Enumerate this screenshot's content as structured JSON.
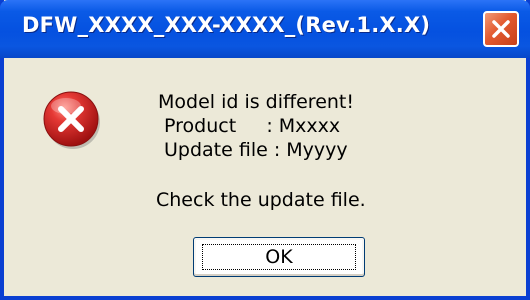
{
  "window": {
    "title": "DFW_XXXX_XXX-XXXX_(Rev.1.X.X)"
  },
  "message": {
    "line1": "Model id is different!",
    "line2": "Product     : Mxxxx",
    "line3": "Update file : Myyyy",
    "instruction": "Check the update file."
  },
  "buttons": {
    "ok_label": "OK"
  },
  "icons": {
    "error": "error-icon",
    "close": "close-icon"
  },
  "colors": {
    "titlebar": "#0551e0",
    "close_button": "#e35a2f",
    "error_icon": "#d92020",
    "dialog_background": "#ece9d8"
  }
}
